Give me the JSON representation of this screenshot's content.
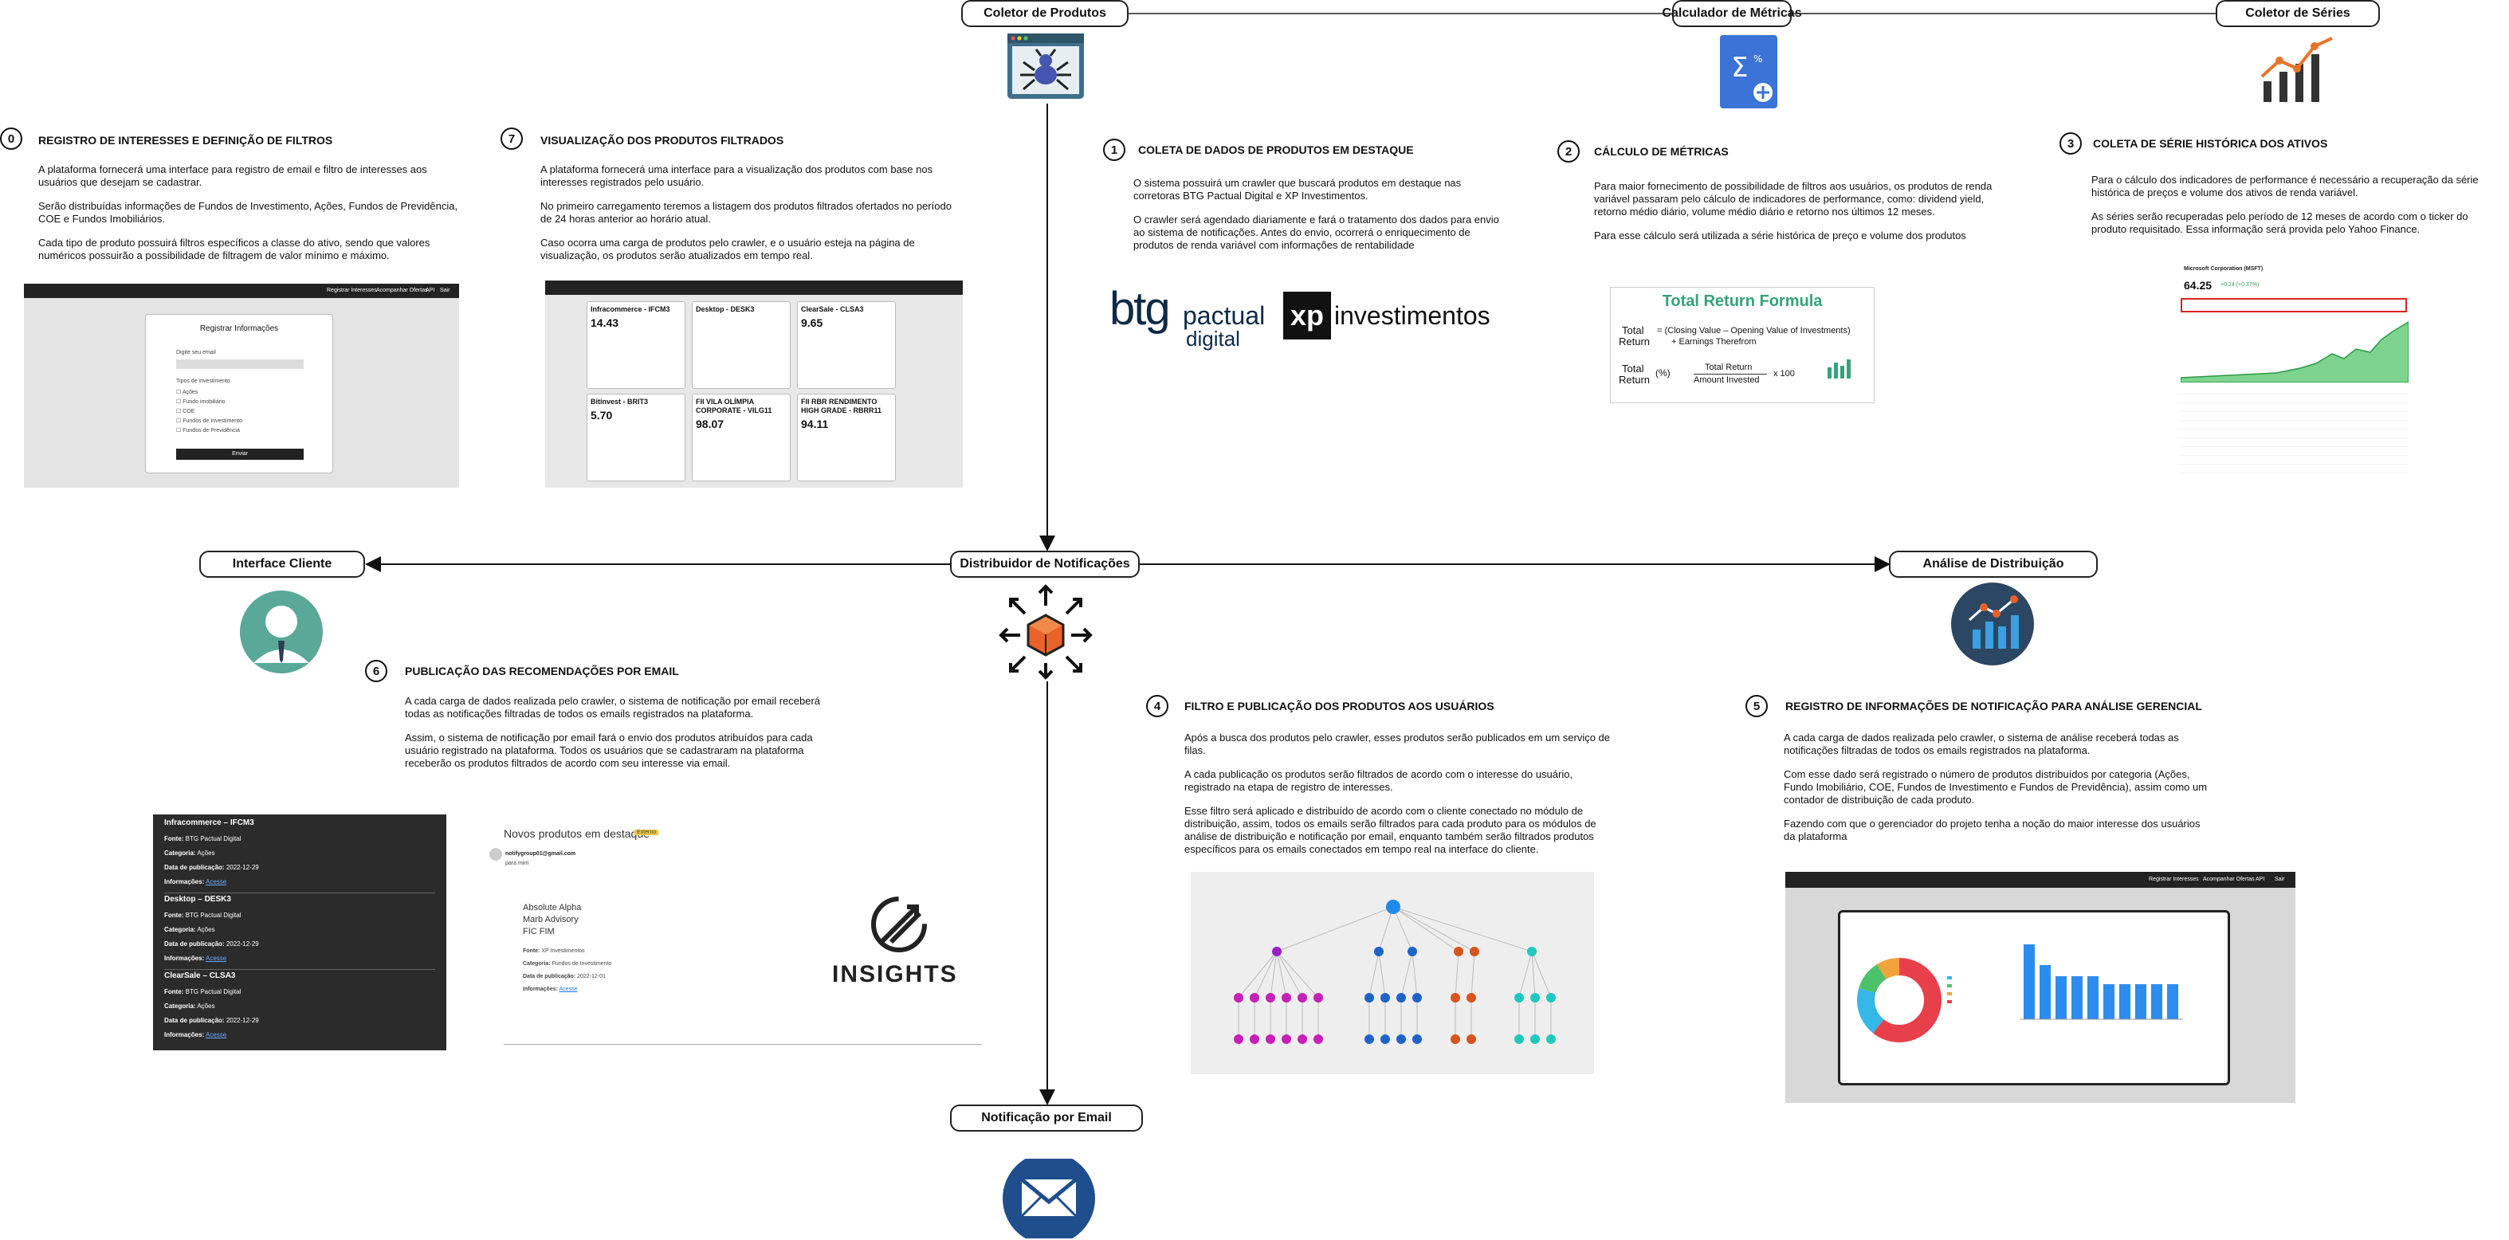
{
  "nodes": {
    "coletor_produtos": "Coletor de Produtos",
    "calculador_metricas": "Calculador de Métricas",
    "coletor_series": "Coletor de Séries",
    "interface_cliente": "Interface Cliente",
    "distribuidor": "Distribuidor de Notificações",
    "analise_distribuicao": "Análise de Distribuição",
    "notificacao_email": "Notificação por Email"
  },
  "sections": [
    {
      "num": "0",
      "title": "REGISTRO DE INTERESSES E DEFINIÇÃO DE FILTROS",
      "paragraphs": [
        "A plataforma fornecerá uma interface para registro de email e filtro de interesses aos usuários que desejam se cadastrar.",
        "Serão distribuídas informações de Fundos de Investimento, Ações, Fundos de Previdência, COE e Fundos Imobiliários.",
        "Cada tipo de produto possuirá filtros específicos a classe do ativo, sendo que valores numéricos possuirão a possibilidade de filtragem de valor mínimo e máximo."
      ]
    },
    {
      "num": "7",
      "title": "VISUALIZAÇÃO DOS PRODUTOS FILTRADOS",
      "paragraphs": [
        "A plataforma fornecerá uma interface para a visualização dos produtos com base nos interesses registrados pelo usuário.",
        "No primeiro carregamento teremos a listagem dos produtos filtrados ofertados no período de 24 horas anterior ao horário atual.",
        "Caso ocorra uma carga de produtos pelo crawler, e o usuário esteja na página de visualização, os produtos serão atualizados em tempo real."
      ]
    },
    {
      "num": "1",
      "title": "COLETA DE DADOS DE PRODUTOS EM DESTAQUE",
      "paragraphs": [
        "O sistema possuirá um crawler que buscará produtos em destaque nas corretoras BTG Pactual Digital e XP Investimentos.",
        "O crawler será agendado diariamente e fará o tratamento dos dados para envio ao sistema de notificações. Antes do envio, ocorrerá o enriquecimento de produtos de renda variável com informações de rentabilidade"
      ]
    },
    {
      "num": "2",
      "title": "CÁLCULO DE MÉTRICAS",
      "paragraphs": [
        "Para maior fornecimento de possibilidade de filtros aos usuários, os produtos de renda variável passaram pelo cálculo de indicadores de performance, como: dividend yield, retorno médio diário, volume médio diário e retorno nos últimos 12 meses.",
        "Para esse cálculo será utilizada a série histórica de preço e volume dos produtos"
      ]
    },
    {
      "num": "3",
      "title": "COLETA DE SÉRIE HISTÓRICA DOS ATIVOS",
      "paragraphs": [
        "Para o cálculo dos indicadores de performance é necessário a recuperação da série histórica de preços e volume dos ativos de renda variável.",
        "As séries serão recuperadas pelo período de 12 meses de acordo com o ticker do produto requisitado. Essa informação será provida pelo Yahoo Finance."
      ]
    },
    {
      "num": "6",
      "title": "PUBLICAÇÃO DAS RECOMENDAÇÕES POR EMAIL",
      "paragraphs": [
        "A cada carga de dados realizada pelo crawler, o sistema de notificação por email receberá todas as notificações filtradas de todos os emails registrados na plataforma.",
        "Assim, o sistema de notificação por email fará o envio dos produtos atribuídos para cada usuário registrado na plataforma. Todos os usuários que se cadastraram na plataforma receberão os produtos filtrados de acordo com seu interesse via email."
      ]
    },
    {
      "num": "4",
      "title": "FILTRO E PUBLICAÇÃO DOS PRODUTOS AOS USUÁRIOS",
      "paragraphs": [
        "Após a busca dos produtos pelo crawler, esses produtos serão publicados em um serviço de filas.",
        "A cada publicação os produtos serão filtrados de acordo com o interesse do usuário, registrado na etapa de registro de interesses.",
        "Esse filtro será aplicado e distribuído de acordo com o cliente conectado no módulo de distribuição, assim, todos os emails serão filtrados para cada produto para os módulos de análise de distribuição e notificação por email, enquanto também serão filtrados produtos específicos para os emails conectados em tempo real na interface do cliente."
      ]
    },
    {
      "num": "5",
      "title": "REGISTRO DE INFORMAÇÕES DE NOTIFICAÇÃO PARA ANÁLISE GERENCIAL",
      "paragraphs": [
        "A cada carga de dados realizada pelo crawler, o sistema de análise receberá todas as notificações filtradas de todos os emails registrados na plataforma.",
        "Com esse dado será registrado o número de produtos distribuídos por categoria (Ações, Fundo Imobiliário, COE, Fundos de Investimento e Fundos de Previdência), assim como um contador de distribuição de cada produto.",
        "Fazendo com que o gerenciador do projeto tenha a noção do maior interesse dos usuários da plataforma"
      ]
    }
  ],
  "brands": {
    "btg_main": "btg",
    "btg_pactual": "pactual",
    "btg_digital": "digital",
    "xp_mark": "xp",
    "xp_text": "investimentos",
    "insights": "INSIGHTS"
  },
  "formula": {
    "title": "Total Return Formula",
    "left1": "Total",
    "left2": "Return",
    "eq1": "= (Closing Value – Opening Value of Investments)",
    "eq1b": "+ Earnings Therefrom",
    "pct1": "Total",
    "pct2": "Return",
    "pct3": "(%)",
    "num": "Total Return",
    "den": "Amount Invested",
    "times": "x 100"
  },
  "registration": {
    "title": "Registrar Informações",
    "email_label": "Digite seu email",
    "interest_label": "Tipos de investimento",
    "options": [
      "Ações",
      "Fundo imobiliário",
      "COE",
      "Fundos de Investimento",
      "Fundos de Previdência"
    ],
    "submit": "Enviar",
    "nav": [
      "Registrar Interesses",
      "Acompanhar Ofertas",
      "API",
      "Sair"
    ]
  },
  "products": [
    {
      "name": "Infracommerce - IFCM3",
      "price": "14.43"
    },
    {
      "name": "Desktop - DESK3",
      "price": ""
    },
    {
      "name": "ClearSale - CLSA3",
      "price": "9.65"
    },
    {
      "name": "Bitinvest - BRIT3",
      "price": "5.70"
    },
    {
      "name": "FII VILA OLÍMPIA CORPORATE - VILG11",
      "price": "98.07"
    },
    {
      "name": "FII RBR RENDIMENTO HIGH GRADE - RBRR11",
      "price": "94.11"
    }
  ],
  "stock": {
    "title": "Microsoft Corporation (MSFT)",
    "price": "64.25",
    "change": "+0.24 (+0.37%)"
  },
  "email_list": [
    {
      "name": "Infracommerce – IFCM3",
      "fonte": "BTG Pactual Digital",
      "categoria": "Ações",
      "data": "2022-12-29"
    },
    {
      "name": "Desktop – DESK3",
      "fonte": "BTG Pactual Digital",
      "categoria": "Ações",
      "data": "2022-12-29"
    },
    {
      "name": "ClearSale – CLSA3",
      "fonte": "BTG Pactual Digital",
      "categoria": "Ações",
      "data": "2022-12-29"
    }
  ],
  "email_labels": {
    "fonte": "Fonte:",
    "categoria": "Categoria:",
    "data": "Data de publicação:",
    "info": "Informações:",
    "link": "Acesse"
  },
  "email_view": {
    "subject": "Novos produtos em destaque",
    "tag": "Externo",
    "from": "notifygroup01@gmail.com",
    "to": "para mim",
    "body": [
      "Absolute Alpha",
      "Marb Advisory",
      "FIC FIM"
    ],
    "fonte": "XP Investimentos",
    "categoria": "Fundos de Investimento",
    "data": "2022-12-01"
  }
}
